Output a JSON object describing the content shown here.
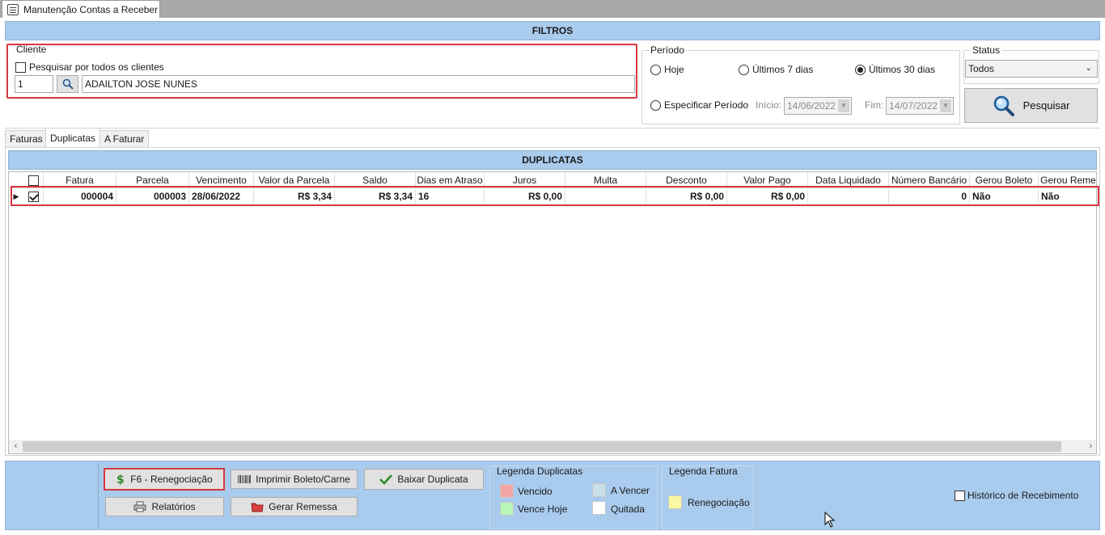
{
  "window": {
    "tab_title": "Manutenção Contas a Receber"
  },
  "filters": {
    "header": "FILTROS",
    "cliente": {
      "title": "Cliente",
      "all_clients_label": "Pesquisar por todos os clientes",
      "all_clients_checked": false,
      "code": "1",
      "name": "ADAILTON JOSE NUNES"
    },
    "periodo": {
      "title": "Período",
      "options": [
        "Hoje",
        "Últimos 7 dias",
        "Últimos 30 dias",
        "Especificar Período"
      ],
      "selected": "Últimos 30 dias",
      "inicio_label": "Início:",
      "inicio_value": "14/06/2022",
      "fim_label": "Fim:",
      "fim_value": "14/07/2022"
    },
    "status": {
      "title": "Status",
      "selected": "Todos"
    },
    "search_button": "Pesquisar"
  },
  "tabs": [
    {
      "label": "Faturas",
      "active": false
    },
    {
      "label": "Duplicatas",
      "active": true
    },
    {
      "label": "A Faturar",
      "active": false
    }
  ],
  "duplicatas": {
    "header": "DUPLICATAS",
    "columns": [
      "Fatura",
      "Parcela",
      "Vencimento",
      "Valor da Parcela",
      "Saldo",
      "Dias em Atraso",
      "Juros",
      "Multa",
      "Desconto",
      "Valor Pago",
      "Data Liquidado",
      "Número Bancário",
      "Gerou Boleto",
      "Gerou Reme"
    ],
    "rows": [
      {
        "selected": true,
        "fatura": "000004",
        "parcela": "000003",
        "vencimento": "28/06/2022",
        "valor_parcela": "R$ 3,34",
        "saldo": "R$ 3,34",
        "dias_atraso": "16",
        "juros": "R$ 0,00",
        "multa": "",
        "desconto": "R$ 0,00",
        "valor_pago": "R$ 0,00",
        "data_liquidado": "",
        "numero_bancario": "0",
        "gerou_boleto": "Não",
        "gerou_remessa": "Não"
      }
    ]
  },
  "actions": {
    "renegociacao": "F6 - Renegociação",
    "imprimir": "Imprimir Boleto/Carne",
    "baixar": "Baixar Duplicata",
    "relatorios": "Relatórios",
    "remessa": "Gerar Remessa"
  },
  "legend_duplicatas": {
    "title": "Legenda Duplicatas",
    "items": [
      {
        "label": "Vencido",
        "color": "#f4a6a6"
      },
      {
        "label": "A Vencer",
        "color": "#c9e0ea"
      },
      {
        "label": "Vence Hoje",
        "color": "#b9f5b9"
      },
      {
        "label": "Quitada",
        "color": "#ffffff"
      }
    ]
  },
  "legend_fatura": {
    "title": "Legenda Fatura",
    "items": [
      {
        "label": "Renegociação",
        "color": "#fbf7a0"
      }
    ]
  },
  "historico": {
    "label": "Histórico de Recebimento",
    "checked": false
  },
  "colors": {
    "header_blue": "#a9cbed",
    "highlight_red": "#d6383f"
  }
}
